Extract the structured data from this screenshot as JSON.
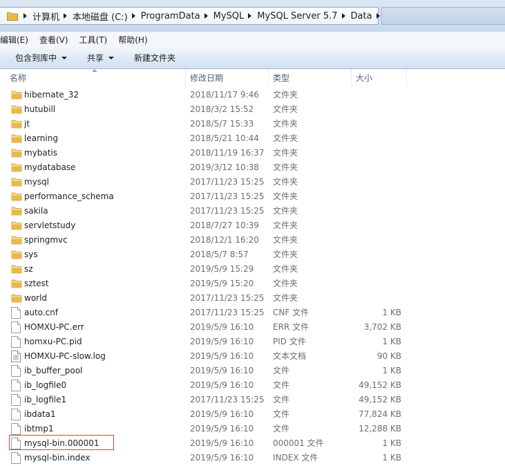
{
  "address_bar": {
    "crumbs": [
      "计算机",
      "本地磁盘 (C:)",
      "ProgramData",
      "MySQL",
      "MySQL Server 5.7",
      "Data"
    ]
  },
  "menubar": {
    "items": [
      "编辑(E)",
      "查看(V)",
      "工具(T)",
      "帮助(H)"
    ]
  },
  "toolbar": {
    "include_library": "包含到库中",
    "share": "共享",
    "new_folder": "新建文件夹"
  },
  "columns": {
    "name": "名称",
    "date": "修改日期",
    "type": "类型",
    "size": "大小"
  },
  "files": [
    {
      "name": "hibernate_32",
      "date": "2018/11/17 9:46",
      "type": "文件夹",
      "size": "",
      "icon": "folder-icon"
    },
    {
      "name": "hutubill",
      "date": "2018/3/2 15:52",
      "type": "文件夹",
      "size": "",
      "icon": "folder-icon"
    },
    {
      "name": "jt",
      "date": "2018/5/7 15:33",
      "type": "文件夹",
      "size": "",
      "icon": "folder-icon"
    },
    {
      "name": "learning",
      "date": "2018/5/21 10:44",
      "type": "文件夹",
      "size": "",
      "icon": "folder-icon"
    },
    {
      "name": "mybatis",
      "date": "2018/11/19 16:37",
      "type": "文件夹",
      "size": "",
      "icon": "folder-icon"
    },
    {
      "name": "mydatabase",
      "date": "2019/3/12 10:38",
      "type": "文件夹",
      "size": "",
      "icon": "folder-icon"
    },
    {
      "name": "mysql",
      "date": "2017/11/23 15:25",
      "type": "文件夹",
      "size": "",
      "icon": "folder-icon"
    },
    {
      "name": "performance_schema",
      "date": "2017/11/23 15:25",
      "type": "文件夹",
      "size": "",
      "icon": "folder-icon"
    },
    {
      "name": "sakila",
      "date": "2017/11/23 15:25",
      "type": "文件夹",
      "size": "",
      "icon": "folder-icon"
    },
    {
      "name": "servletstudy",
      "date": "2018/7/27 10:39",
      "type": "文件夹",
      "size": "",
      "icon": "folder-icon"
    },
    {
      "name": "springmvc",
      "date": "2018/12/1 16:20",
      "type": "文件夹",
      "size": "",
      "icon": "folder-icon"
    },
    {
      "name": "sys",
      "date": "2018/5/7 8:57",
      "type": "文件夹",
      "size": "",
      "icon": "folder-icon"
    },
    {
      "name": "sz",
      "date": "2019/5/9 15:29",
      "type": "文件夹",
      "size": "",
      "icon": "folder-icon"
    },
    {
      "name": "sztest",
      "date": "2019/5/9 15:20",
      "type": "文件夹",
      "size": "",
      "icon": "folder-icon"
    },
    {
      "name": "world",
      "date": "2017/11/23 15:25",
      "type": "文件夹",
      "size": "",
      "icon": "folder-icon"
    },
    {
      "name": "auto.cnf",
      "date": "2017/11/23 15:25",
      "type": "CNF 文件",
      "size": "1 KB",
      "icon": "file-icon"
    },
    {
      "name": "HOMXU-PC.err",
      "date": "2019/5/9 16:10",
      "type": "ERR 文件",
      "size": "3,702 KB",
      "icon": "file-icon"
    },
    {
      "name": "homxu-PC.pid",
      "date": "2019/5/9 16:10",
      "type": "PID 文件",
      "size": "1 KB",
      "icon": "file-icon"
    },
    {
      "name": "HOMXU-PC-slow.log",
      "date": "2019/5/9 16:10",
      "type": "文本文档",
      "size": "90 KB",
      "icon": "text-file-icon"
    },
    {
      "name": "ib_buffer_pool",
      "date": "2019/5/9 16:10",
      "type": "文件",
      "size": "1 KB",
      "icon": "file-icon"
    },
    {
      "name": "ib_logfile0",
      "date": "2019/5/9 16:10",
      "type": "文件",
      "size": "49,152 KB",
      "icon": "file-icon"
    },
    {
      "name": "ib_logfile1",
      "date": "2017/11/23 15:25",
      "type": "文件",
      "size": "49,152 KB",
      "icon": "file-icon"
    },
    {
      "name": "ibdata1",
      "date": "2019/5/9 16:10",
      "type": "文件",
      "size": "77,824 KB",
      "icon": "file-icon"
    },
    {
      "name": "ibtmp1",
      "date": "2019/5/9 16:10",
      "type": "文件",
      "size": "12,288 KB",
      "icon": "file-icon"
    },
    {
      "name": "mysql-bin.000001",
      "date": "2019/5/9 16:10",
      "type": "000001 文件",
      "size": "1 KB",
      "icon": "file-icon"
    },
    {
      "name": "mysql-bin.index",
      "date": "2019/5/9 16:10",
      "type": "INDEX 文件",
      "size": "1 KB",
      "icon": "file-icon"
    }
  ],
  "colors": {
    "folder": "#e8b84a",
    "highlight": "#e23b3b",
    "toolbar_bg": "#dde8f5",
    "secondary_text": "#6d6d6d"
  }
}
